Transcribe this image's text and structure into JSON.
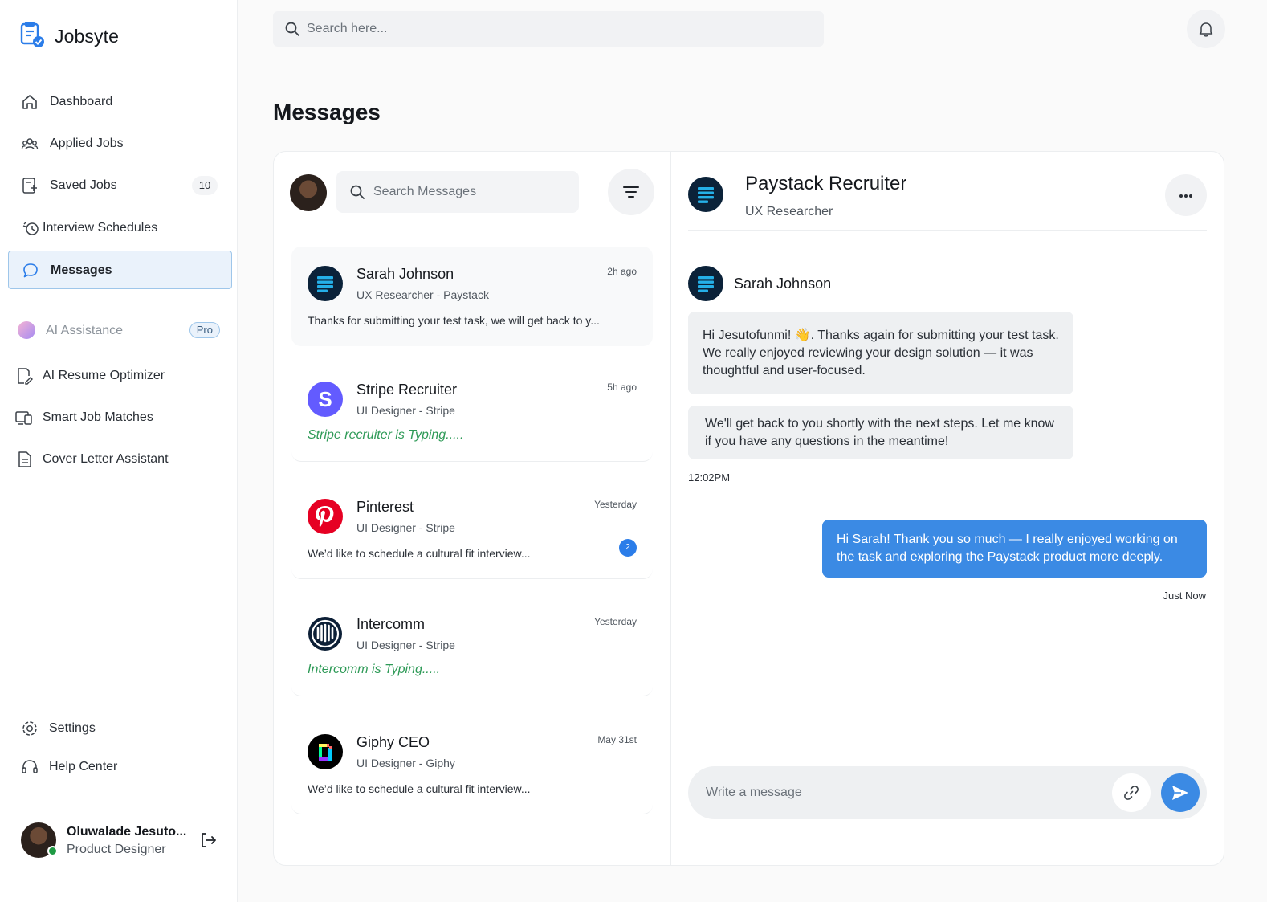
{
  "app": {
    "name": "Jobsyte"
  },
  "sidebar": {
    "items": [
      {
        "label": "Dashboard"
      },
      {
        "label": "Applied Jobs"
      },
      {
        "label": "Saved Jobs",
        "count": "10"
      },
      {
        "label": "Interview Schedules"
      },
      {
        "label": "Messages"
      }
    ],
    "ai_section": {
      "label": "AI Assistance",
      "badge": "Pro"
    },
    "ai_items": [
      {
        "label": "AI Resume Optimizer"
      },
      {
        "label": "Smart Job Matches"
      },
      {
        "label": "Cover Letter Assistant"
      }
    ],
    "bottom_items": [
      {
        "label": "Settings"
      },
      {
        "label": "Help Center"
      }
    ],
    "user": {
      "name": "Oluwalade Jesuto...",
      "role": "Product Designer"
    }
  },
  "topbar": {
    "search_placeholder": "Search here..."
  },
  "page": {
    "title": "Messages"
  },
  "messages_list": {
    "search_placeholder": "Search Messages",
    "conversations": [
      {
        "name": "Sarah Johnson",
        "time": "2h ago",
        "role": "UX Researcher - Paystack",
        "preview": "Thanks for submitting your test task, we will get back to y...",
        "typing": false
      },
      {
        "name": "Stripe Recruiter",
        "time": "5h ago",
        "role": "UI Designer - Stripe",
        "preview": "Stripe recruiter is Typing.....",
        "typing": true
      },
      {
        "name": "Pinterest",
        "time": "Yesterday",
        "role": "UI Designer - Stripe",
        "preview": "We’d like to schedule a cultural fit interview...",
        "typing": false,
        "unread": "2"
      },
      {
        "name": "Intercomm",
        "time": "Yesterday",
        "role": "UI Designer - Stripe",
        "preview": "Intercomm is Typing.....",
        "typing": true
      },
      {
        "name": "Giphy CEO",
        "time": "May 31st",
        "role": "UI Designer - Giphy",
        "preview": "We’d like to schedule a cultural fit interview...",
        "typing": false
      }
    ]
  },
  "chat": {
    "title": "Paystack Recruiter",
    "subtitle": "UX Researcher",
    "sender": "Sarah Johnson",
    "incoming": [
      "Hi Jesutofunmi! 👋. Thanks again for submitting your test task. We really enjoyed reviewing your design solution — it was thoughtful and user-focused.",
      "We'll get back to you shortly with the next steps. Let me know if you have any questions in the meantime!"
    ],
    "incoming_time": "12:02PM",
    "outgoing": "Hi Sarah! Thank you so much — I really enjoyed working on the task and exploring the Paystack product more deeply.",
    "outgoing_time": "Just Now",
    "composer_placeholder": "Write a message"
  },
  "colors": {
    "accent": "#3b8ae4",
    "typing": "#2e9a57",
    "active_nav_bg": "#eaf2fb",
    "paystack": "#0b2239",
    "stripe": "#635bff",
    "pinterest": "#e60023"
  }
}
